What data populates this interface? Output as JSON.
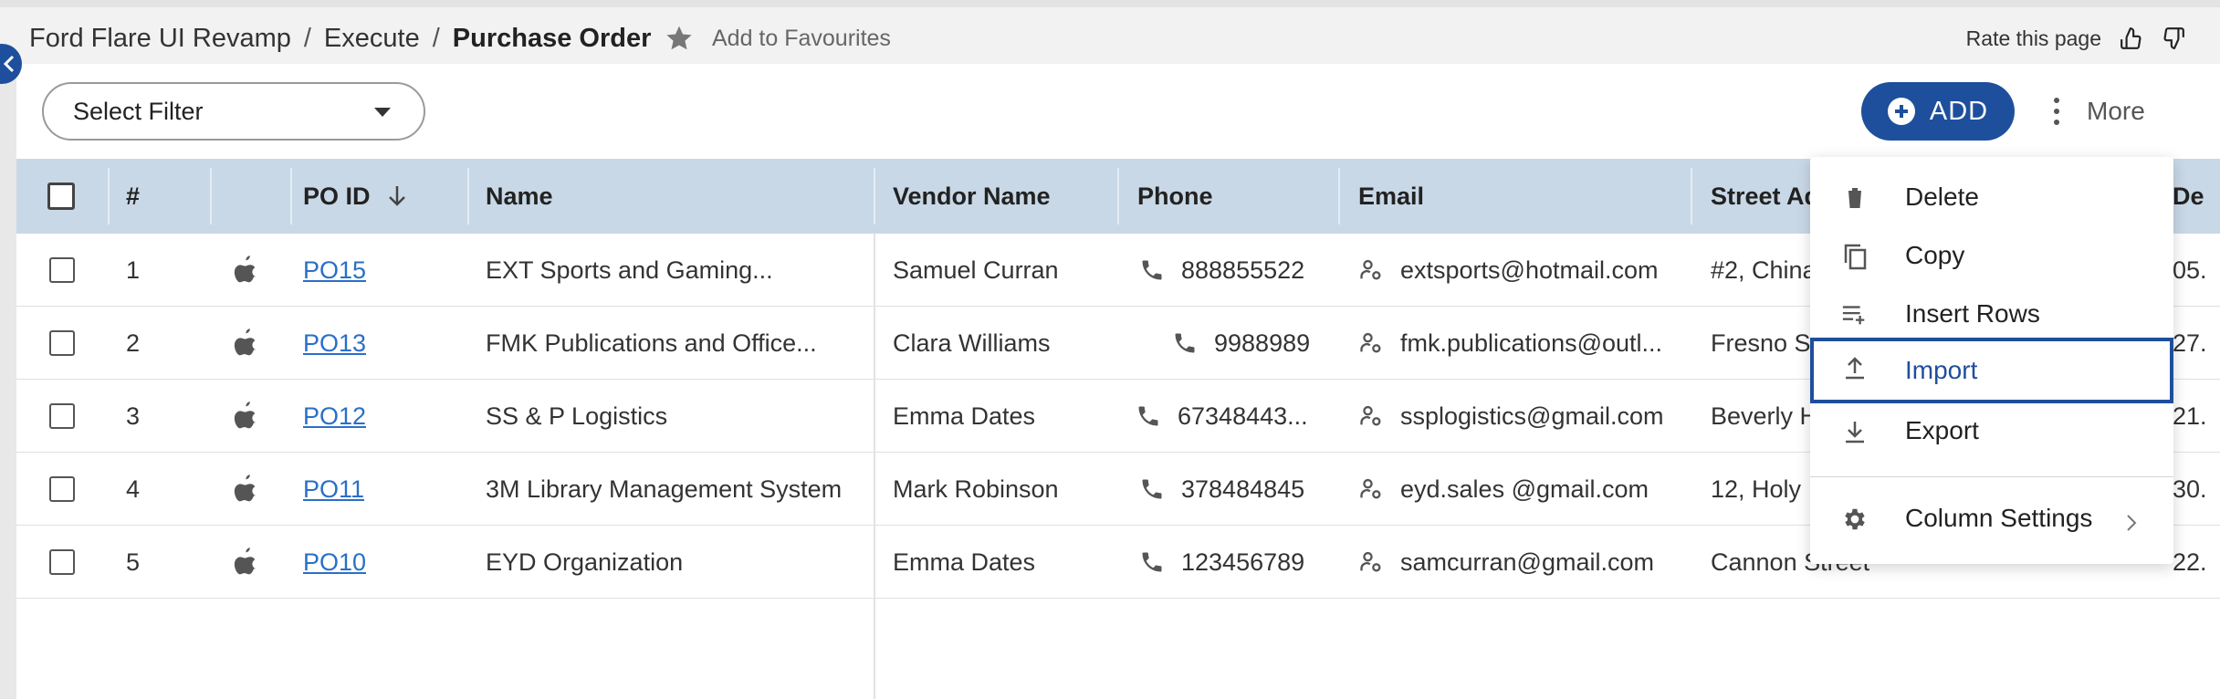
{
  "breadcrumb": {
    "items": [
      "Ford Flare UI Revamp",
      "Execute"
    ],
    "current": "Purchase Order",
    "separator": "/"
  },
  "favourites": {
    "label": "Add to Favourites",
    "icon": "star-icon"
  },
  "rating": {
    "label": "Rate this page",
    "up_icon": "thumbs-up-icon",
    "down_icon": "thumbs-down-icon"
  },
  "toolbar": {
    "filter_label": "Select Filter",
    "add_label": "ADD",
    "more_label": "More"
  },
  "table": {
    "columns": {
      "index": "#",
      "po_id": "PO ID",
      "name": "Name",
      "vendor": "Vendor Name",
      "phone": "Phone",
      "email": "Email",
      "street": "Street Ad",
      "extra": "De"
    },
    "rows": [
      {
        "index": "1",
        "po_id": "PO15",
        "name": "EXT Sports and Gaming...",
        "vendor": "Samuel Curran",
        "phone": "888855522",
        "email": "extsports@hotmail.com",
        "street": "#2, China",
        "extra": "05."
      },
      {
        "index": "2",
        "po_id": "PO13",
        "name": "FMK Publications and Office...",
        "vendor": "Clara Williams",
        "phone": "9988989",
        "email": "fmk.publications@outl...",
        "street": "Fresno S",
        "extra": "27."
      },
      {
        "index": "3",
        "po_id": "PO12",
        "name": "SS & P Logistics",
        "vendor": "Emma Dates",
        "phone": "67348443...",
        "email": "ssplogistics@gmail.com",
        "street": "Beverly H",
        "extra": "21."
      },
      {
        "index": "4",
        "po_id": "PO11",
        "name": "3M Library Management System",
        "vendor": "Mark Robinson",
        "phone": "378484845",
        "email": "eyd.sales @gmail.com",
        "street": "12, Holy",
        "extra": "30."
      },
      {
        "index": "5",
        "po_id": "PO10",
        "name": "EYD Organization",
        "vendor": "Emma Dates",
        "phone": "123456789",
        "email": "samcurran@gmail.com",
        "street": "Cannon Street",
        "extra": "22."
      }
    ]
  },
  "more_menu": {
    "items": [
      {
        "label": "Delete",
        "icon": "trash-icon"
      },
      {
        "label": "Copy",
        "icon": "copy-icon"
      },
      {
        "label": "Insert Rows",
        "icon": "insert-rows-icon"
      },
      {
        "label": "Import",
        "icon": "upload-icon"
      },
      {
        "label": "Export",
        "icon": "download-icon"
      }
    ],
    "column_settings": {
      "label": "Column Settings",
      "icon": "gear-icon"
    },
    "active_item": "Import"
  },
  "colors": {
    "primary": "#1e4f9c",
    "header_bg": "#c9d8e7",
    "link": "#2a6fc7"
  }
}
